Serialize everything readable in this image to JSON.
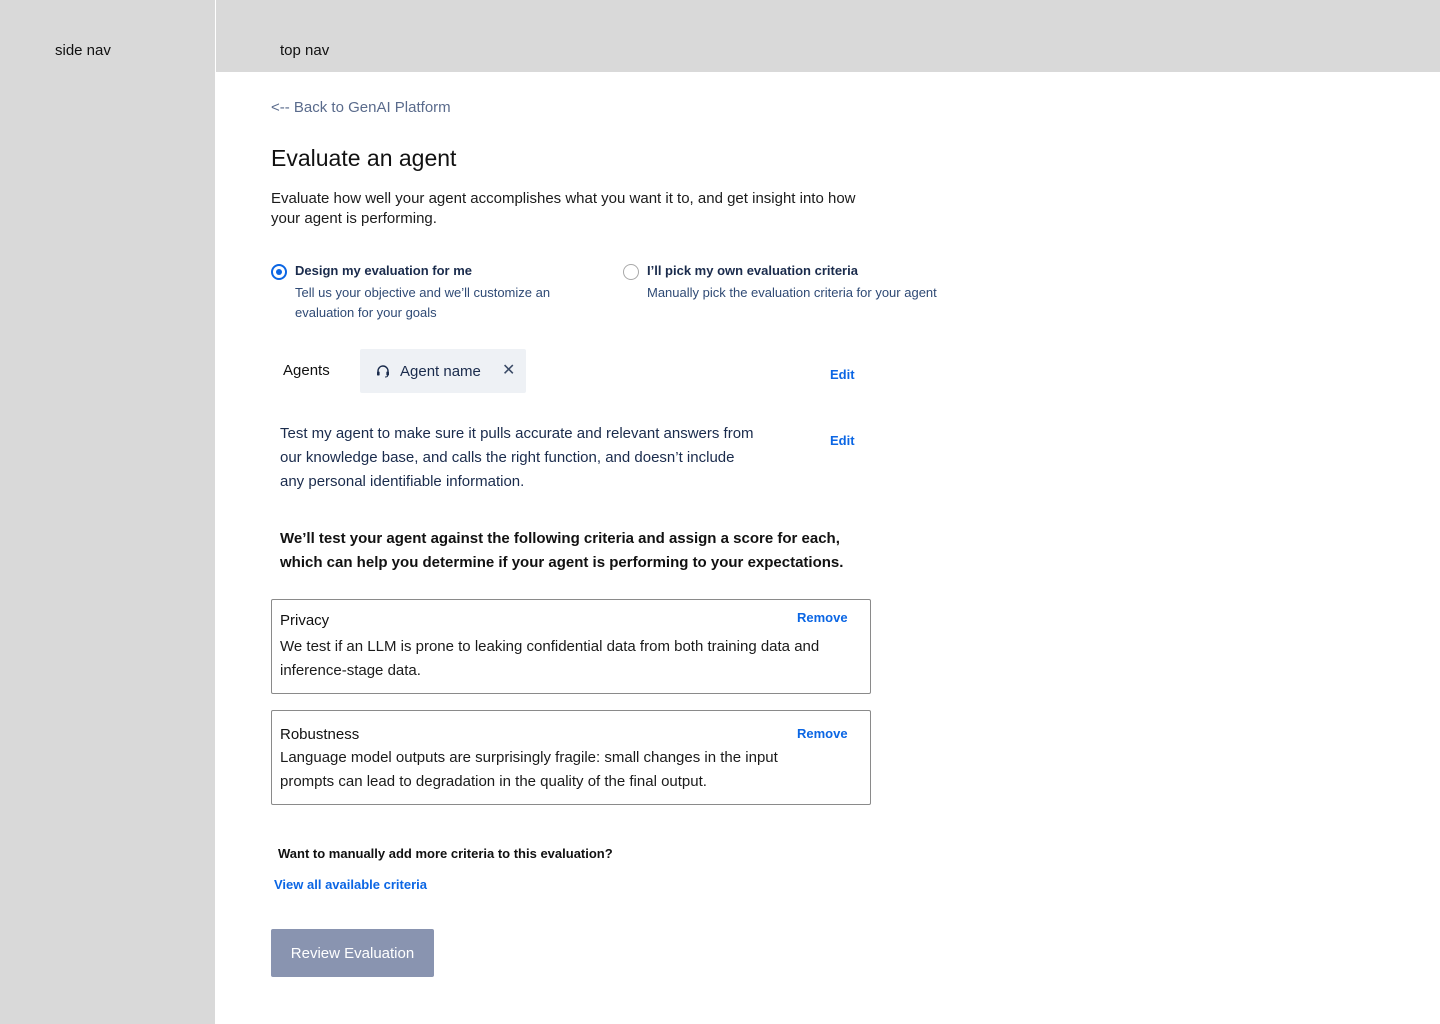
{
  "side_nav": {
    "label": "side nav"
  },
  "top_nav": {
    "label": "top nav"
  },
  "main": {
    "back_link": "<-- Back to GenAI Platform",
    "title": "Evaluate an agent",
    "description": "Evaluate how well your agent accomplishes what you want it to, and get insight into how your agent is performing.",
    "options": [
      {
        "title": "Design my evaluation for me",
        "subtitle": "Tell us your objective and we’ll customize an evaluation for your goals",
        "selected": true
      },
      {
        "title": "I’ll pick my own evaluation criteria",
        "subtitle": "Manually pick the evaluation criteria for your agent",
        "selected": false
      }
    ],
    "agents": {
      "label": "Agents",
      "chip_label": "Agent name",
      "chip_icon": "headset-icon",
      "close_icon": "✕",
      "edit_label": "Edit"
    },
    "objective": {
      "text": "Test my agent to make sure it pulls accurate and relevant answers from our knowledge base, and calls the right function, and doesn’t include any personal identifiable information.",
      "edit_label": "Edit"
    },
    "criteria_intro": "We’ll test your agent against the following criteria and assign a score for each, which can help you determine if your agent is performing to your expectations.",
    "criteria": [
      {
        "title": "Privacy",
        "description": "We test if an LLM is prone to leaking confidential data from both training data and inference-stage data.",
        "remove_label": "Remove"
      },
      {
        "title": "Robustness",
        "description": "Language model outputs are surprisingly fragile: small changes in the input prompts can lead to degradation in the quality of the final output.",
        "remove_label": "Remove"
      }
    ],
    "more_question": "Want to manually add more criteria to this evaluation?",
    "view_criteria_link": "View all available criteria",
    "review_button": "Review Evaluation"
  },
  "colors": {
    "accent": "#0b66e4",
    "nav_background": "#d9d9d9",
    "button_disabled": "#8994b0",
    "text_link_muted": "#5a6b8c"
  }
}
